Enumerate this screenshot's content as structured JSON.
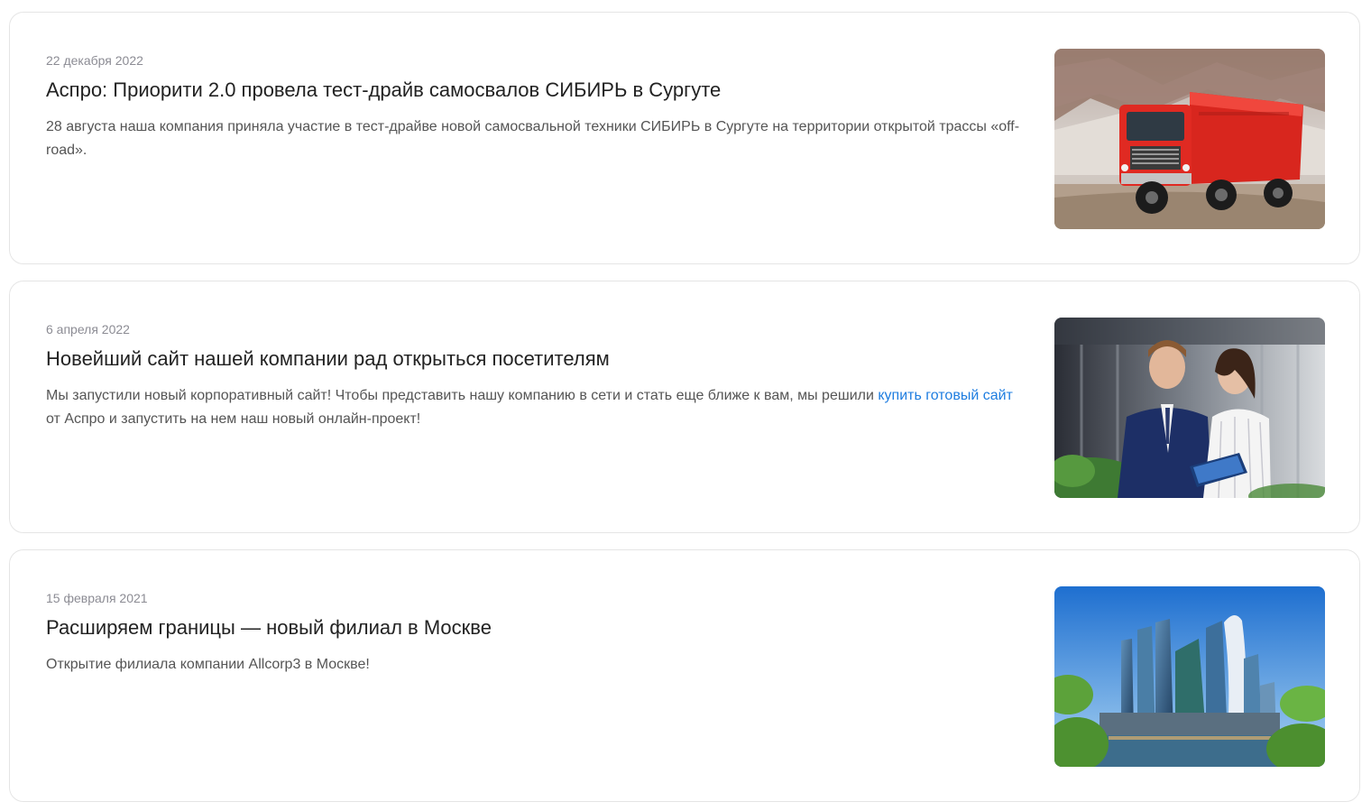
{
  "news": [
    {
      "date": "22 декабря 2022",
      "title": "Аспро: Приорити 2.0 провела тест-драйв самосвалов СИБИРЬ в Сургуте",
      "desc": "28 августа наша компания приняла участие в тест-драйве новой самосвальной техники СИБИРЬ в Сургуте на территории открытой трассы «off-road».",
      "image": "red-dump-truck-photo"
    },
    {
      "date": "6 апреля 2022",
      "title": "Новейший сайт нашей компании рад открыться посетителям",
      "desc_before": "Мы запустили новый корпоративный сайт! Чтобы представить нашу компанию в сети и стать еще ближе к вам, мы решили ",
      "desc_link": "купить готовый сайт",
      "desc_after": " от Аспро и запустить на нем наш новый онлайн-проект!",
      "image": "business-people-tablet-photo"
    },
    {
      "date": "15 февраля 2021",
      "title": "Расширяем границы — новый филиал в Москве",
      "desc": "Открытие филиала компании Allcorp3 в Москве!",
      "image": "moscow-city-skyscrapers-photo"
    }
  ],
  "colors": {
    "date": "#8c8c94",
    "title": "#222222",
    "text": "#555555",
    "link": "#1e7de0",
    "border": "#e5e5e5"
  }
}
